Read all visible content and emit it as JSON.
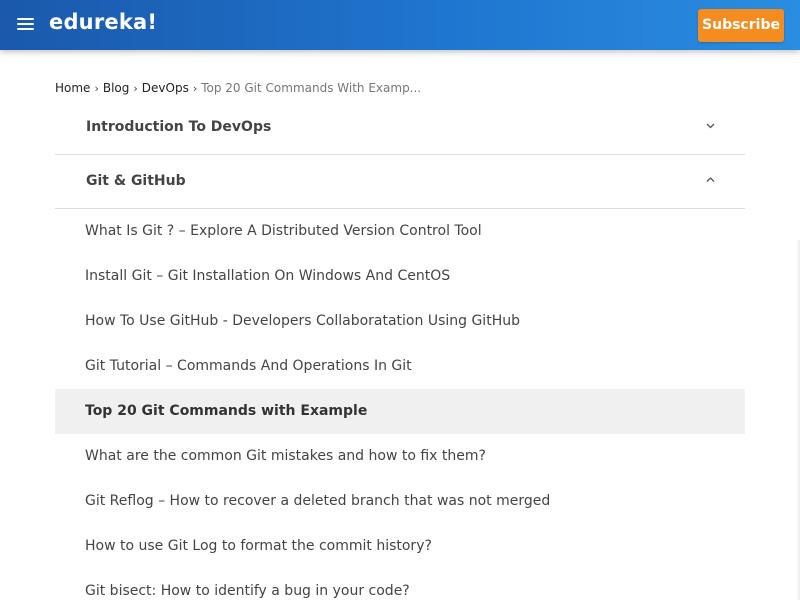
{
  "header": {
    "menu_icon": "hamburger-menu-icon",
    "logo_text": "edureka!",
    "subscribe_label": "Subscribe",
    "colors": {
      "bar": "#1f75cf",
      "subscribe": "#f58c1f"
    }
  },
  "breadcrumb": {
    "items": [
      "Home",
      "Blog",
      "DevOps"
    ],
    "current": "Top 20 Git Commands With Examp...",
    "separator_icon": "chevron-right-icon"
  },
  "accordion": {
    "sections": [
      {
        "title": "Introduction To DevOps",
        "expanded": false,
        "icon": "chevron-down-icon"
      },
      {
        "title": "Git & GitHub",
        "expanded": true,
        "icon": "chevron-up-icon",
        "items": [
          "What Is Git ? – Explore A Distributed Version Control Tool",
          "Install Git – Git Installation On Windows And CentOS",
          "How To Use GitHub - Developers Collaboratation Using GitHub",
          "Git Tutorial – Commands And Operations In Git",
          "Top 20 Git Commands with Example",
          "What are the common Git mistakes and how to fix them?",
          "Git Reflog – How to recover a deleted branch that was not merged",
          "How to use Git Log to format the commit history?",
          "Git bisect: How to identify a bug in your code?"
        ],
        "active_item": "Top 20 Git Commands with Example"
      }
    ]
  }
}
